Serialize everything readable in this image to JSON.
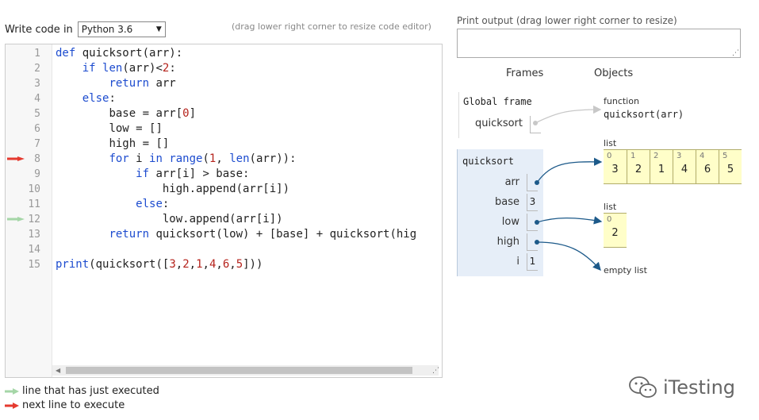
{
  "editor_header": {
    "write_label": "Write code in",
    "language": "Python 3.6",
    "drag_hint": "(drag lower right corner to resize code editor)"
  },
  "code": [
    {
      "n": "1",
      "indent": "",
      "tokens": [
        {
          "t": "def",
          "c": "kw"
        },
        {
          "t": " quicksort(arr):",
          "c": ""
        }
      ]
    },
    {
      "n": "2",
      "indent": "    ",
      "tokens": [
        {
          "t": "if",
          "c": "kw"
        },
        {
          "t": " ",
          "c": ""
        },
        {
          "t": "len",
          "c": "kw"
        },
        {
          "t": "(arr)<",
          "c": ""
        },
        {
          "t": "2",
          "c": "num"
        },
        {
          "t": ":",
          "c": ""
        }
      ]
    },
    {
      "n": "3",
      "indent": "        ",
      "tokens": [
        {
          "t": "return",
          "c": "kw"
        },
        {
          "t": " arr",
          "c": ""
        }
      ]
    },
    {
      "n": "4",
      "indent": "    ",
      "tokens": [
        {
          "t": "else",
          "c": "kw"
        },
        {
          "t": ":",
          "c": ""
        }
      ]
    },
    {
      "n": "5",
      "indent": "        ",
      "tokens": [
        {
          "t": "base = arr[",
          "c": ""
        },
        {
          "t": "0",
          "c": "num"
        },
        {
          "t": "]",
          "c": ""
        }
      ]
    },
    {
      "n": "6",
      "indent": "        ",
      "tokens": [
        {
          "t": "low = []",
          "c": ""
        }
      ]
    },
    {
      "n": "7",
      "indent": "        ",
      "tokens": [
        {
          "t": "high = []",
          "c": ""
        }
      ]
    },
    {
      "n": "8",
      "indent": "        ",
      "tokens": [
        {
          "t": "for",
          "c": "kw"
        },
        {
          "t": " i ",
          "c": ""
        },
        {
          "t": "in",
          "c": "kw"
        },
        {
          "t": " ",
          "c": ""
        },
        {
          "t": "range",
          "c": "kw"
        },
        {
          "t": "(",
          "c": ""
        },
        {
          "t": "1",
          "c": "num"
        },
        {
          "t": ", ",
          "c": ""
        },
        {
          "t": "len",
          "c": "kw"
        },
        {
          "t": "(arr)):",
          "c": ""
        }
      ],
      "marker": "next"
    },
    {
      "n": "9",
      "indent": "            ",
      "tokens": [
        {
          "t": "if",
          "c": "kw"
        },
        {
          "t": " arr[i] > base:",
          "c": ""
        }
      ]
    },
    {
      "n": "10",
      "indent": "                ",
      "tokens": [
        {
          "t": "high.append(arr[i])",
          "c": ""
        }
      ]
    },
    {
      "n": "11",
      "indent": "            ",
      "tokens": [
        {
          "t": "else",
          "c": "kw"
        },
        {
          "t": ":",
          "c": ""
        }
      ]
    },
    {
      "n": "12",
      "indent": "                ",
      "tokens": [
        {
          "t": "low.append(arr[i])",
          "c": ""
        }
      ],
      "marker": "executed"
    },
    {
      "n": "13",
      "indent": "        ",
      "tokens": [
        {
          "t": "return",
          "c": "kw"
        },
        {
          "t": " quicksort(low) + [base] + quicksort(hig",
          "c": ""
        }
      ]
    },
    {
      "n": "14",
      "indent": "",
      "tokens": []
    },
    {
      "n": "15",
      "indent": "",
      "tokens": [
        {
          "t": "print",
          "c": "kw"
        },
        {
          "t": "(quicksort([",
          "c": ""
        },
        {
          "t": "3",
          "c": "num"
        },
        {
          "t": ",",
          "c": ""
        },
        {
          "t": "2",
          "c": "num"
        },
        {
          "t": ",",
          "c": ""
        },
        {
          "t": "1",
          "c": "num"
        },
        {
          "t": ",",
          "c": ""
        },
        {
          "t": "4",
          "c": "num"
        },
        {
          "t": ",",
          "c": ""
        },
        {
          "t": "6",
          "c": "num"
        },
        {
          "t": ",",
          "c": ""
        },
        {
          "t": "5",
          "c": "num"
        },
        {
          "t": "]))",
          "c": ""
        }
      ]
    }
  ],
  "legend": {
    "executed_label": "line that has just executed",
    "next_label": "next line to execute"
  },
  "output": {
    "print_label": "Print output (drag lower right corner to resize)"
  },
  "viz": {
    "frames_header": "Frames",
    "objects_header": "Objects",
    "global_frame": {
      "title": "Global frame",
      "vars": [
        {
          "name": "quicksort"
        }
      ]
    },
    "quicksort_frame": {
      "title": "quicksort",
      "vars": [
        {
          "name": "arr",
          "value": ""
        },
        {
          "name": "base",
          "value": "3"
        },
        {
          "name": "low",
          "value": ""
        },
        {
          "name": "high",
          "value": ""
        },
        {
          "name": "i",
          "value": "1"
        }
      ]
    },
    "function_object": {
      "type": "function",
      "label": "quicksort(arr)"
    },
    "list_arr": {
      "type": "list",
      "indices": [
        "0",
        "1",
        "2",
        "3",
        "4",
        "5"
      ],
      "values": [
        "3",
        "2",
        "1",
        "4",
        "6",
        "5"
      ]
    },
    "list_low": {
      "type": "list",
      "indices": [
        "0"
      ],
      "values": [
        "2"
      ]
    },
    "empty_list": {
      "label": "empty list"
    }
  },
  "watermark": {
    "text": "iTesting"
  },
  "colors": {
    "next_arrow": "#e53a2f",
    "executed_arrow": "#a5d6a7",
    "pointer": "#1d5a8a",
    "list_bg": "#fffec9",
    "frame_bg": "#e6eef8"
  }
}
